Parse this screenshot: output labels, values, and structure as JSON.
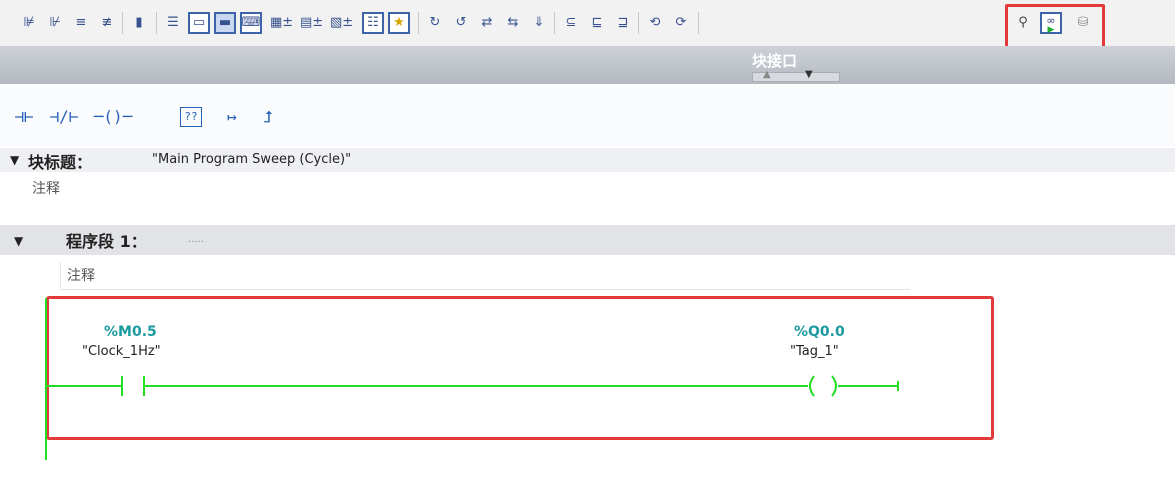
{
  "toolbar": {
    "icons": [
      "insert-network-icon",
      "delete-network-icon",
      "insert-rung-icon",
      "delete-rung-icon",
      "tag-icon",
      "align-left-icon",
      "open-box-icon",
      "close-box-icon",
      "comment-icon",
      "absolute-address-icon",
      "symbolic-address-icon",
      "tag-info-icon",
      "list-box-icon",
      "favorites-icon",
      "jump-to-icon",
      "jump-back-icon",
      "compare-icon",
      "compare-all-icon",
      "download-icon",
      "list-one-icon",
      "list-two-icon",
      "list-three-icon",
      "previous-error-icon",
      "next-error-icon",
      "go-online-icon",
      "monitor-glasses-icon",
      "snapshot-icon"
    ]
  },
  "block_interface": {
    "label": "块接口"
  },
  "palette": {
    "items": [
      {
        "name": "no-contact-icon",
        "glyph": "⊣⊢"
      },
      {
        "name": "nc-contact-icon",
        "glyph": "⊣/⊢"
      },
      {
        "name": "coil-icon",
        "glyph": "─()─"
      },
      {
        "name": "empty-box-icon",
        "glyph": "??"
      },
      {
        "name": "open-branch-icon",
        "glyph": "↦"
      },
      {
        "name": "close-branch-icon",
        "glyph": "⮥"
      }
    ]
  },
  "block": {
    "title_label": "块标题：",
    "title_value": "\"Main Program Sweep (Cycle)\"",
    "comment": "注释"
  },
  "network": {
    "label": "程序段 1：",
    "title": ".....",
    "comment": "注释",
    "contact": {
      "address": "%M0.5",
      "name": "\"Clock_1Hz\""
    },
    "coil": {
      "address": "%Q0.0",
      "name": "\"Tag_1\""
    }
  },
  "colors": {
    "power_flow": "#22dd22",
    "address": "#1b9aa0",
    "highlight": "#e23a3a"
  }
}
